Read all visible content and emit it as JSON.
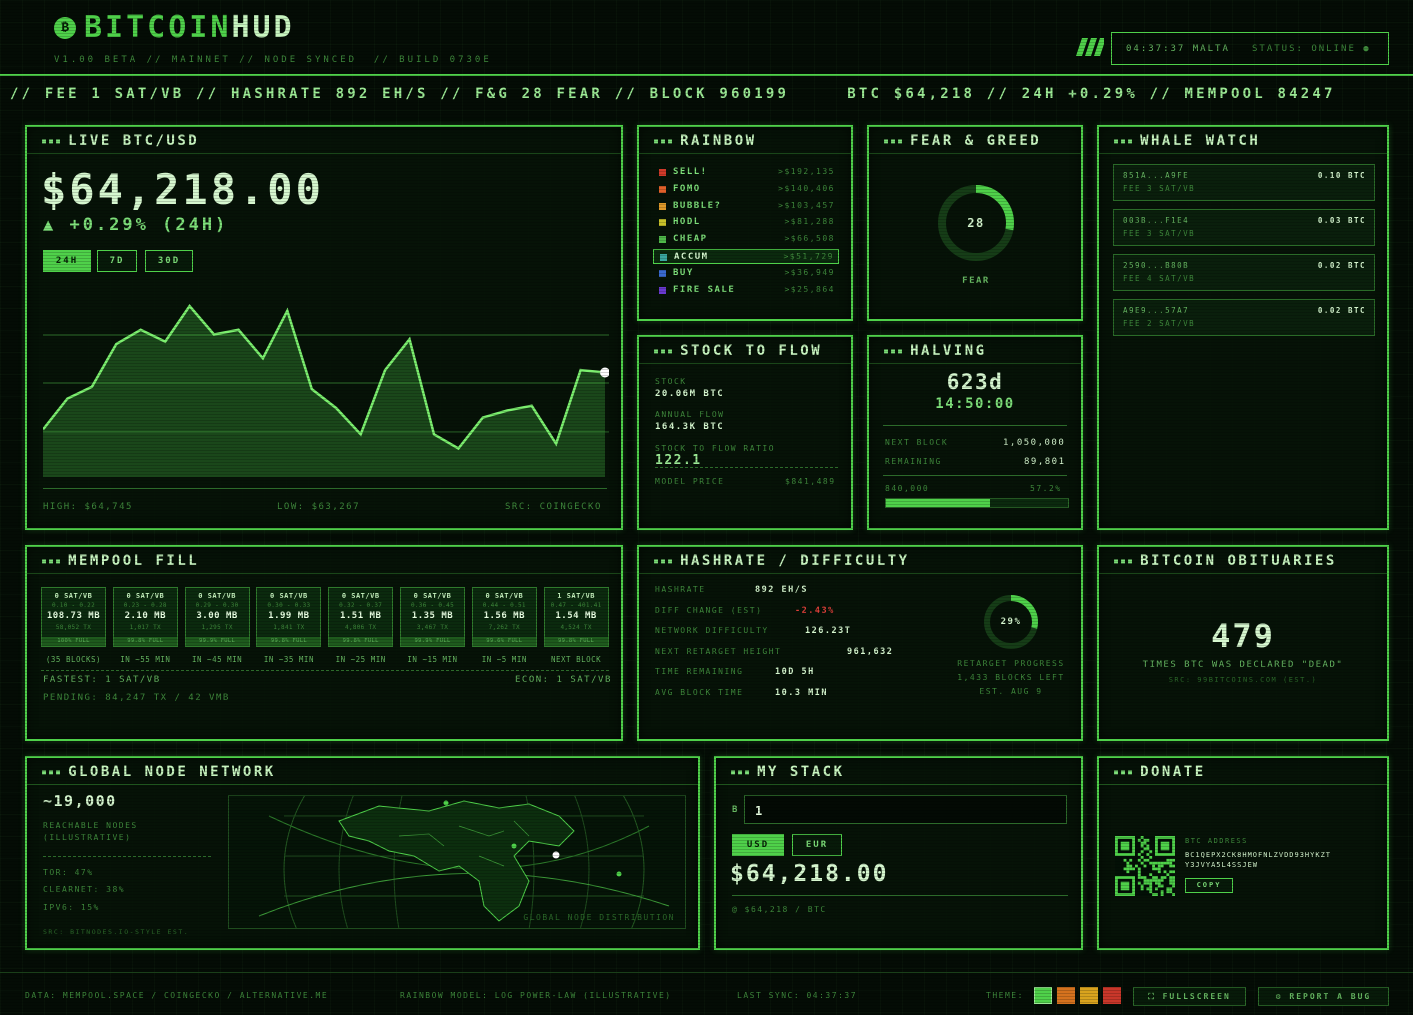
{
  "brand": {
    "name_a": "BITCOIN",
    "name_b": "HUD",
    "subtitle": "V1.00 BETA // MAINNET // NODE SYNCED  // BUILD 0730E"
  },
  "status": {
    "time": "04:37:37 MALTA",
    "label": "STATUS: ONLINE ●"
  },
  "ticker": "// FEE 1 SAT/VB // HASHRATE 892 EH/S // F&G 28 FEAR // BLOCK 960199     BTC $64,218 // 24H +0.29% // MEMPOOL 84247",
  "live": {
    "title": "LIVE BTC/USD",
    "price": "$64,218.00",
    "change": "▲ +0.29% (24H)",
    "ranges": [
      "24H",
      "7D",
      "30D"
    ],
    "high": "HIGH: $64,745",
    "low": "LOW: $63,267",
    "src": "SRC: COINGECKO"
  },
  "chart_data": {
    "type": "area",
    "values": [
      20,
      33,
      38,
      56,
      62,
      57,
      72,
      60,
      62,
      50,
      70,
      37,
      29,
      18,
      45,
      58,
      18,
      12,
      25,
      28,
      30,
      14,
      45,
      44
    ]
  },
  "rainbow": {
    "title": "RAINBOW",
    "rows": [
      {
        "label": "SELL!",
        "value": ">$192,135",
        "color": "#d03a2a"
      },
      {
        "label": "FOMO",
        "value": ">$140,406",
        "color": "#e0602a"
      },
      {
        "label": "BUBBLE?",
        "value": ">$103,457",
        "color": "#e09a2a"
      },
      {
        "label": "HODL",
        "value": ">$81,288",
        "color": "#c8c22a"
      },
      {
        "label": "CHEAP",
        "value": ">$66,508",
        "color": "#4fb84a"
      },
      {
        "label": "ACCUM",
        "value": ">$51,729",
        "color": "#3aa8a0"
      },
      {
        "label": "BUY",
        "value": ">$36,949",
        "color": "#3a6ad0"
      },
      {
        "label": "FIRE SALE",
        "value": ">$25,864",
        "color": "#6a3ad0"
      }
    ]
  },
  "fear": {
    "title": "FEAR & GREED",
    "value": "28",
    "label": "FEAR",
    "level": 0.28
  },
  "whale": {
    "title": "WHALE WATCH",
    "items": [
      {
        "addr": "851A...A9FE",
        "fee": "FEE 3 SAT/VB",
        "amount": "0.10 BTC"
      },
      {
        "addr": "003B...F1E4",
        "fee": "FEE 3 SAT/VB",
        "amount": "0.03 BTC"
      },
      {
        "addr": "2590...B80B",
        "fee": "FEE 4 SAT/VB",
        "amount": "0.02 BTC"
      },
      {
        "addr": "A9E9...57A7",
        "fee": "FEE 2 SAT/VB",
        "amount": "0.02 BTC"
      }
    ]
  },
  "s2f": {
    "title": "STOCK TO FLOW",
    "stock_label": "STOCK",
    "stock_value": "20.06M BTC",
    "flow_label": "ANNUAL FLOW",
    "flow_value": "164.3K BTC",
    "ratio_label": "STOCK TO FLOW RATIO",
    "ratio_value": "122.1",
    "model_label": "MODEL PRICE",
    "model_value": "$841,489"
  },
  "halving": {
    "title": "HALVING",
    "days": "623d",
    "clock": "14:50:00",
    "next_label": "NEXT BLOCK",
    "next_value": "1,050,000",
    "rem_label": "REMAINING",
    "rem_value": "89,801",
    "prog_left": "840,000",
    "prog_right": "57.2%",
    "progress": 0.572
  },
  "mempool": {
    "title": "MEMPOOL FILL",
    "blocks": [
      {
        "fee": "0 SAT/VB",
        "range": "0.10 - 0.22",
        "size": "108.73 MB",
        "tx": "58,052 TX",
        "fill": "100% FULL",
        "eta": "(35 BLOCKS)"
      },
      {
        "fee": "0 SAT/VB",
        "range": "0.23 - 0.28",
        "size": "2.10 MB",
        "tx": "1,017 TX",
        "fill": "99.8% FULL",
        "eta": "IN ~55 MIN"
      },
      {
        "fee": "0 SAT/VB",
        "range": "0.29 - 0.30",
        "size": "3.00 MB",
        "tx": "1,295 TX",
        "fill": "99.9% FULL",
        "eta": "IN ~45 MIN"
      },
      {
        "fee": "0 SAT/VB",
        "range": "0.30 - 0.33",
        "size": "1.99 MB",
        "tx": "1,841 TX",
        "fill": "99.8% FULL",
        "eta": "IN ~35 MIN"
      },
      {
        "fee": "0 SAT/VB",
        "range": "0.32 - 0.37",
        "size": "1.51 MB",
        "tx": "4,806 TX",
        "fill": "99.8% FULL",
        "eta": "IN ~25 MIN"
      },
      {
        "fee": "0 SAT/VB",
        "range": "0.36 - 0.45",
        "size": "1.35 MB",
        "tx": "3,467 TX",
        "fill": "99.9% FULL",
        "eta": "IN ~15 MIN"
      },
      {
        "fee": "0 SAT/VB",
        "range": "0.44 - 0.51",
        "size": "1.56 MB",
        "tx": "7,262 TX",
        "fill": "99.6% FULL",
        "eta": "IN ~5 MIN"
      },
      {
        "fee": "1 SAT/VB",
        "range": "0.47 - 401.41",
        "size": "1.54 MB",
        "tx": "4,524 TX",
        "fill": "99.8% FULL",
        "eta": "NEXT BLOCK"
      }
    ],
    "fastest": "FASTEST: 1 SAT/VB",
    "econ": "ECON: 1 SAT/VB",
    "pending": "PENDING: 84,247 TX / 42 VMB"
  },
  "hash": {
    "title": "HASHRATE / DIFFICULTY",
    "rows": [
      {
        "label": "HASHRATE",
        "value": "892 EH/S"
      },
      {
        "label": "DIFF CHANGE (EST)",
        "value": "-2.43%"
      },
      {
        "label": "NETWORK DIFFICULTY",
        "value": "126.23T"
      },
      {
        "label": "NEXT RETARGET HEIGHT",
        "value": "961,632"
      },
      {
        "label": "TIME REMAINING",
        "value": "10D 5H"
      },
      {
        "label": "AVG BLOCK TIME",
        "value": "10.3 MIN"
      }
    ],
    "ring_value": "29%",
    "ring_level": 0.29,
    "retarget": "RETARGET PROGRESS",
    "blocks_left": "1,433 BLOCKS LEFT",
    "est": "EST. AUG 9"
  },
  "obit": {
    "title": "BITCOIN OBITUARIES",
    "value": "479",
    "caption": "TIMES BTC WAS DECLARED \"DEAD\"",
    "src": "SRC: 99BITCOINS.COM (EST.)"
  },
  "nodes": {
    "title": "GLOBAL NODE NETWORK",
    "count": "~19,000",
    "caption1": "REACHABLE NODES",
    "caption2": "(ILLUSTRATIVE)",
    "tor": "TOR: 47%",
    "clearnet": "CLEARNET: 38%",
    "ipv6": "IPV6: 15%",
    "src": "SRC: BITNODES.IO-STYLE EST.",
    "map_label": "GLOBAL NODE DISTRIBUTION"
  },
  "stack": {
    "title": "MY STACK",
    "symbol": "B",
    "input_value": "1",
    "currencies": [
      "USD",
      "EUR"
    ],
    "value": "$64,218.00",
    "rate": "@ $64,218 / BTC"
  },
  "donate": {
    "title": "DONATE",
    "addr_label": "BTC ADDRESS",
    "addr1": "BC1QEPX2CK8HMOFNLZVDD93HYKZT",
    "addr2": "Y3JVYA5L4SSJEW",
    "copy": "COPY"
  },
  "footer": {
    "data": "DATA: MEMPOOL.SPACE / COINGECKO / ALTERNATIVE.ME",
    "model": "RAINBOW MODEL: LOG POWER-LAW (ILLUSTRATIVE)",
    "sync": "LAST SYNC: 04:37:37",
    "theme": "THEME:",
    "theme_colors": [
      "#4fd14a",
      "#d4721e",
      "#d8a31e",
      "#c8372a"
    ],
    "fullscreen": "⛶ FULLSCREEN",
    "report": "⚙ REPORT A BUG"
  }
}
